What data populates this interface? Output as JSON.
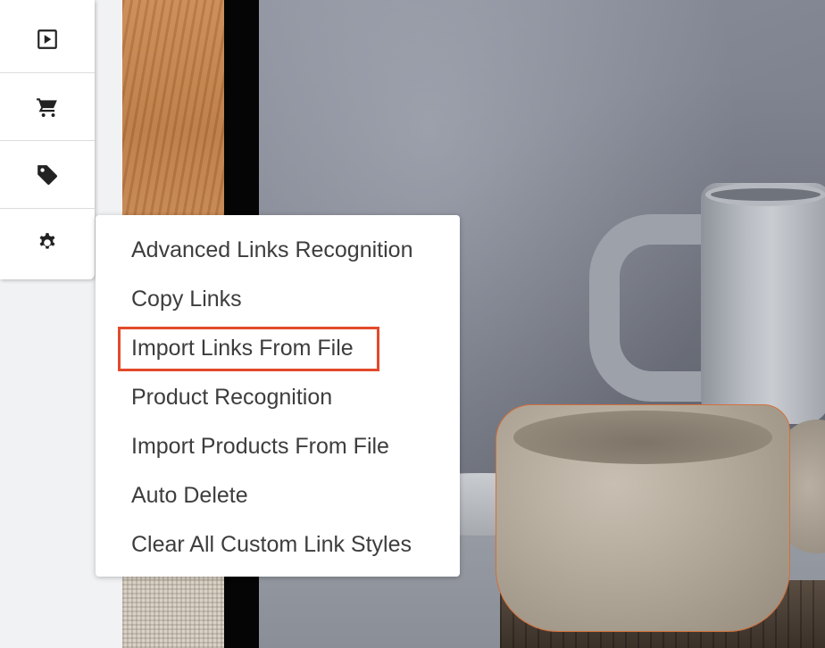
{
  "toolbar": {
    "buttons": [
      {
        "name": "play-icon"
      },
      {
        "name": "cart-icon"
      },
      {
        "name": "tag-icon"
      },
      {
        "name": "gear-icon"
      }
    ]
  },
  "menu": {
    "items": [
      "Advanced Links Recognition",
      "Copy Links",
      "Import Links From File",
      "Product Recognition",
      "Import Products From File",
      "Auto Delete",
      "Clear All Custom Link Styles"
    ],
    "highlighted_item": "Import Links From File"
  },
  "colors": {
    "highlight": "#e24a2a",
    "menu_text": "#3d3d3d"
  }
}
